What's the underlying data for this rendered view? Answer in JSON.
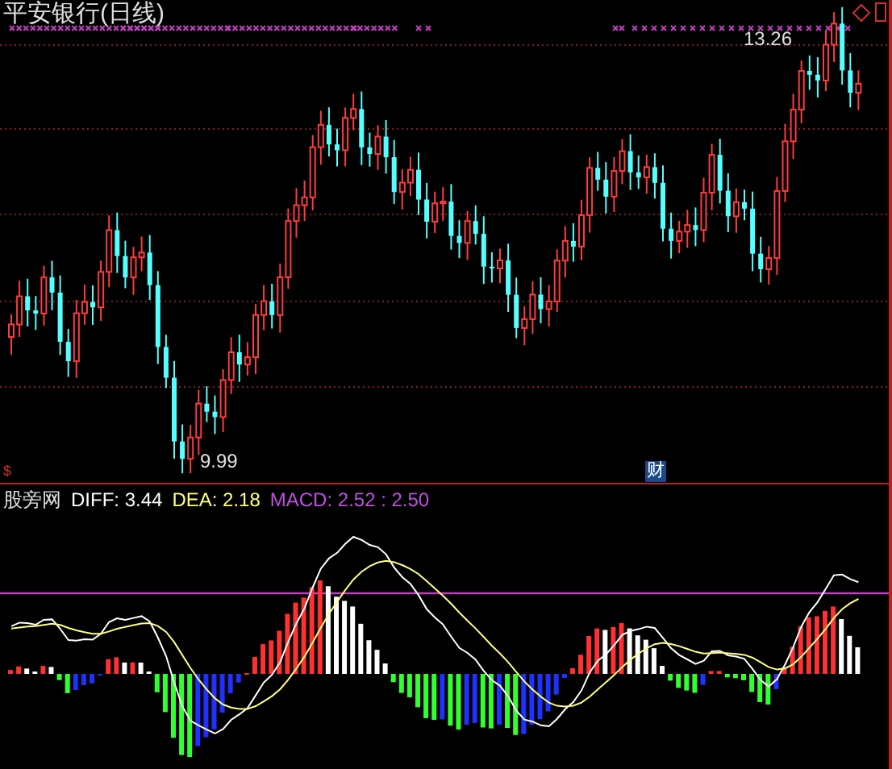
{
  "title": "平安银行(日线)",
  "price_chart": {
    "high_label": "13.26",
    "low_label": "9.99",
    "event_marker": "财",
    "symbol_marker": "$"
  },
  "indicator": {
    "name": "股旁网",
    "diff": "DIFF: 3.44",
    "dea": "DEA: 2.18",
    "macd": "MACD: 2.52 : 2.50"
  }
}
